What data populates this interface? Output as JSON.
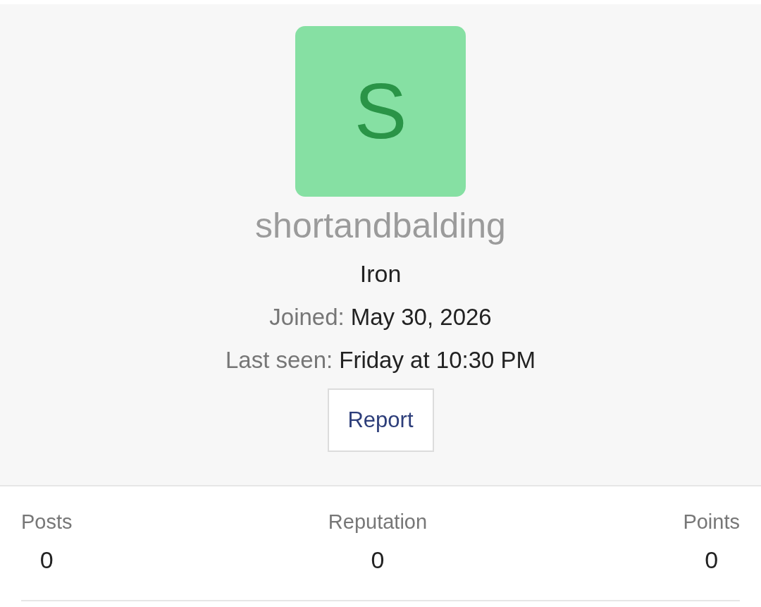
{
  "profile": {
    "avatar_letter": "S",
    "username": "shortandbalding",
    "rank": "Iron",
    "details": [
      {
        "label": "Joined:",
        "value": "May 30, 2026"
      },
      {
        "label": "Last seen:",
        "value": "Friday at 10:30 PM"
      }
    ],
    "report_button": "Report"
  },
  "stats": [
    {
      "label": "Posts",
      "value": "0"
    },
    {
      "label": "Reputation",
      "value": "0"
    },
    {
      "label": "Points",
      "value": "0"
    }
  ]
}
